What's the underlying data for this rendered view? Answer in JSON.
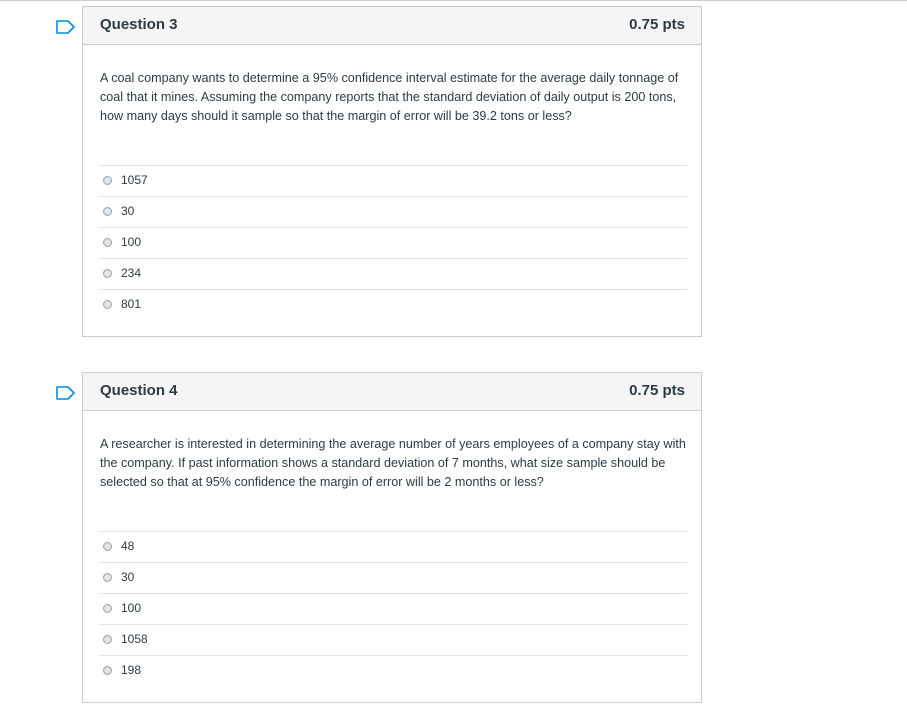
{
  "questions": [
    {
      "title": "Question 3",
      "points": "0.75 pts",
      "text": "A coal company wants to determine a 95% confidence interval estimate for the average daily tonnage of coal that it mines. Assuming the company reports that the standard deviation of daily output is 200 tons, how many days should it sample so that the margin of error will be 39.2 tons or less?",
      "answers": [
        "1057",
        "30",
        "100",
        "234",
        "801"
      ]
    },
    {
      "title": "Question 4",
      "points": "0.75 pts",
      "text": "A researcher is interested in determining the average number of years employees of a company stay with the company. If past information shows a standard deviation of 7 months, what size sample should be selected so that at 95% confidence the margin of error will be 2 months or less?",
      "answers": [
        "48",
        "30",
        "100",
        "1058",
        "198"
      ]
    }
  ],
  "colors": {
    "accent": "#008ee2",
    "border": "#c7cdd1",
    "header_bg": "#f5f5f5",
    "text": "#2d3b45"
  },
  "icons": {
    "flag": "flag-question-icon",
    "radio": "radio-button-icon"
  }
}
